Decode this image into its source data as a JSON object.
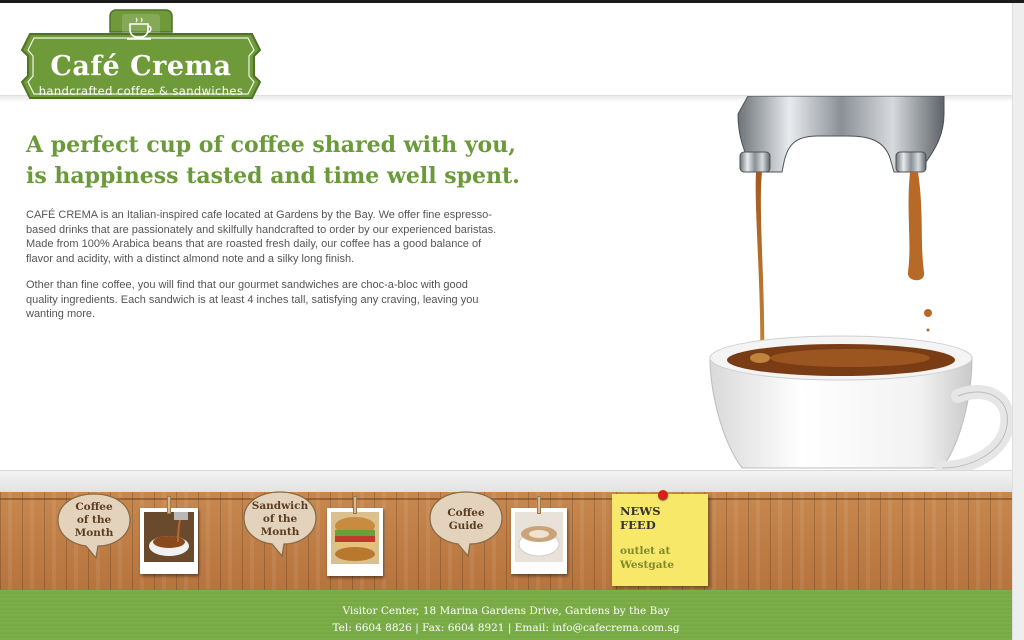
{
  "logo": {
    "title": "Café Crema",
    "subtitle": "handcrafted coffee & sandwiches",
    "color": "#6f9a3a"
  },
  "intro": {
    "headline_line1": "A perfect cup of coffee shared with you,",
    "headline_line2": "is happiness tasted and time well spent.",
    "paragraph1": "CAFÉ CREMA is an Italian-inspired cafe located at Gardens by the Bay. We offer fine espresso-based drinks that are passionately and skilfully handcrafted to order by our experienced baristas. Made from 100% Arabica beans that are roasted fresh daily, our coffee has a good balance of flavor and acidity, with a distinct almond note and a silky long finish.",
    "paragraph2": "Other than fine coffee, you will find that our gourmet sandwiches are choc-a-bloc with good quality ingredients. Each sandwich is at least 4 inches tall, satisfying any craving, leaving you wanting more."
  },
  "features": [
    {
      "line1": "Coffee",
      "line2": "of the",
      "line3": "Month"
    },
    {
      "line1": "Sandwich",
      "line2": "of the",
      "line3": "Month"
    },
    {
      "line1": "Coffee",
      "line2": "Guide",
      "line3": ""
    }
  ],
  "news": {
    "title": "NEWS FEED",
    "item": "outlet at Westgate"
  },
  "footer": {
    "address": "Visitor Center, 18 Marina Gardens Drive, Gardens by the Bay",
    "tel": "Tel: 6604 8826",
    "fax": "Fax: 6604 8921",
    "email": "Email: info@cafecrema.com.sg",
    "separator": " | "
  },
  "colors": {
    "accent_green": "#6b9a3a",
    "footer_green": "#78aa44",
    "wood": "#b7733d",
    "note_yellow": "#f7e86a"
  }
}
